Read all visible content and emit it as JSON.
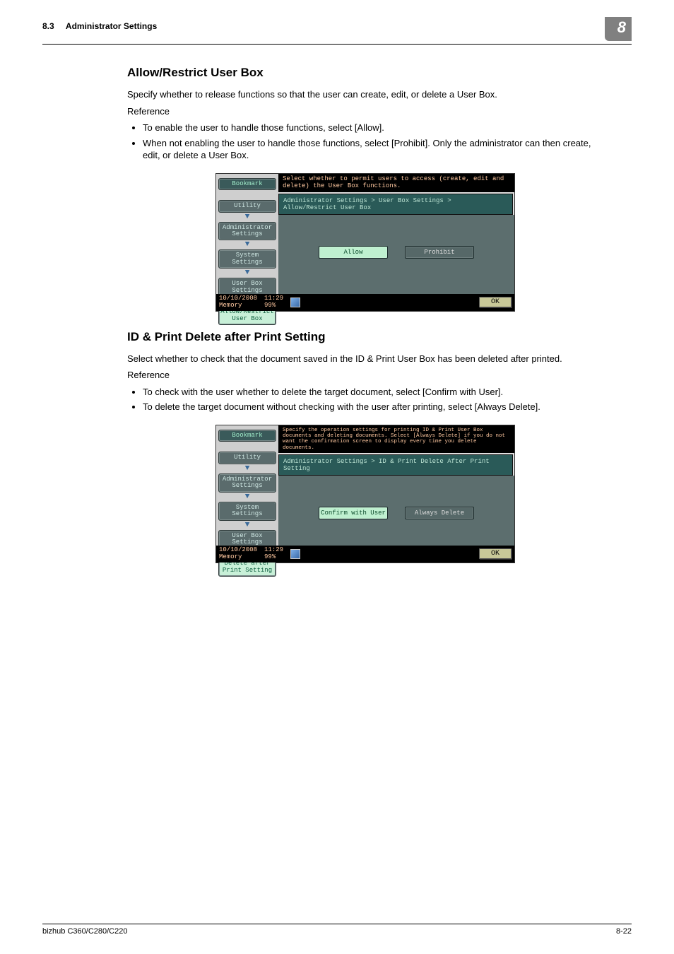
{
  "header": {
    "section_number": "8.3",
    "section_title": "Administrator Settings",
    "chapter": "8"
  },
  "section1": {
    "title": "Allow/Restrict User Box",
    "intro": "Specify whether to release functions so that the user can create, edit, or delete a User Box.",
    "reference_label": "Reference",
    "bullets": [
      "To enable the user to handle those functions, select [Allow].",
      "When not enabling the user to handle those functions, select [Prohibit]. Only the administrator can then create, edit, or delete a User Box."
    ],
    "screen": {
      "help": "Select whether to permit users to access (create, edit and delete) the User Box functions.",
      "breadcrumb": "Administrator Settings > User Box Settings > Allow/Restrict User Box",
      "sidebar": {
        "bookmark": "Bookmark",
        "items": [
          "Utility",
          "Administrator Settings",
          "System Settings",
          "User Box Settings"
        ],
        "current": "Allow/Restrict User Box"
      },
      "options": {
        "selected": "Allow",
        "unselected": "Prohibit"
      },
      "status": {
        "date": "10/10/2008",
        "time": "11:29",
        "memory_label": "Memory",
        "memory_value": "99%",
        "ok": "OK"
      }
    }
  },
  "section2": {
    "title": "ID & Print Delete after Print Setting",
    "intro": "Select whether to check that the document saved in the ID & Print User Box has been deleted after printed.",
    "reference_label": "Reference",
    "bullets": [
      "To check with the user whether to delete the target document, select [Confirm with User].",
      "To delete the target document without checking with the user after printing, select [Always Delete]."
    ],
    "screen": {
      "help": "Specify the operation settings for printing ID & Print User Box documents and deleting documents. Select [Always Delete] if you do not want the confirmation screen to display every time you delete documents.",
      "breadcrumb": "Administrator Settings > ID & Print Delete After Print Setting",
      "sidebar": {
        "bookmark": "Bookmark",
        "items": [
          "Utility",
          "Administrator Settings",
          "System Settings",
          "User Box Settings"
        ],
        "current": "Delete after Print Setting"
      },
      "options": {
        "selected": "Confirm with User",
        "unselected": "Always Delete"
      },
      "status": {
        "date": "10/10/2008",
        "time": "11:29",
        "memory_label": "Memory",
        "memory_value": "99%",
        "ok": "OK"
      }
    }
  },
  "footer": {
    "model": "bizhub C360/C280/C220",
    "page": "8-22"
  }
}
